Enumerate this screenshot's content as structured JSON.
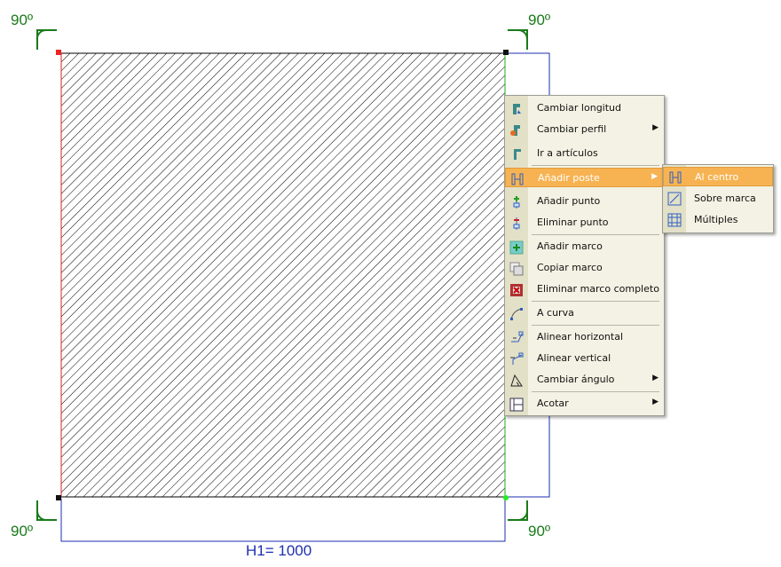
{
  "angles": {
    "top_left": "90º",
    "top_right": "90º",
    "bottom_left": "90º",
    "bottom_right": "90º"
  },
  "dimension": {
    "label": "H1= 1000"
  },
  "context_menu": {
    "items": [
      {
        "label": "Cambiar longitud",
        "icon": "change-length-icon",
        "submenu": false
      },
      {
        "label": "Cambiar perfil",
        "icon": "change-profile-icon",
        "submenu": true
      },
      {
        "label": "Ir a artículos",
        "icon": "go-to-articles-icon",
        "submenu": false
      },
      {
        "label": "Añadir poste",
        "icon": "add-post-icon",
        "submenu": true,
        "highlighted": true
      },
      {
        "label": "Añadir punto",
        "icon": "add-point-icon",
        "submenu": false
      },
      {
        "label": "Eliminar punto",
        "icon": "remove-point-icon",
        "submenu": false
      },
      {
        "label": "Añadir marco",
        "icon": "add-frame-icon",
        "submenu": false
      },
      {
        "label": "Copiar marco",
        "icon": "copy-frame-icon",
        "submenu": false
      },
      {
        "label": "Eliminar marco completo",
        "icon": "delete-frame-icon",
        "submenu": false
      },
      {
        "label": "A curva",
        "icon": "curve-icon",
        "submenu": false
      },
      {
        "label": "Alinear horizontal",
        "icon": "align-horizontal-icon",
        "submenu": false
      },
      {
        "label": "Alinear vertical",
        "icon": "align-vertical-icon",
        "submenu": false
      },
      {
        "label": "Cambiar ángulo",
        "icon": "change-angle-icon",
        "submenu": true
      },
      {
        "label": "Acotar",
        "icon": "dimension-icon",
        "submenu": true
      }
    ]
  },
  "submenu": {
    "items": [
      {
        "label": "Al centro",
        "icon": "post-center-icon",
        "highlighted": true
      },
      {
        "label": "Sobre marca",
        "icon": "post-on-mark-icon"
      },
      {
        "label": "Múltiples",
        "icon": "post-multiple-icon"
      }
    ]
  },
  "colors": {
    "highlight": "#f7b352",
    "angle": "#1a7a1a",
    "dimension": "#1e2fb0"
  }
}
